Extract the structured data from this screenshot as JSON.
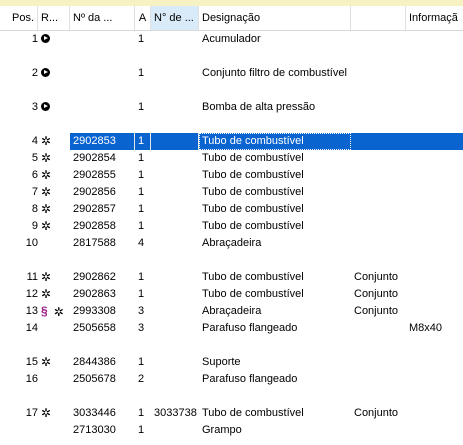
{
  "headers": {
    "pos": "Pos.",
    "ref": "R...",
    "part_no": "Nº da ...",
    "qty": "A",
    "alt_no": "N° de ...",
    "designation": "Designação",
    "assembly": "",
    "info": "Informaçã"
  },
  "rows": [
    {
      "pos": "1",
      "icon": "circle-arrow-icon",
      "num": "",
      "qty": "1",
      "alt": "",
      "desig": "Acumulador",
      "asm": "",
      "info": ""
    },
    {
      "pos": "",
      "icon": "",
      "num": "",
      "qty": "",
      "alt": "",
      "desig": "",
      "asm": "",
      "info": ""
    },
    {
      "pos": "2",
      "icon": "circle-arrow-icon",
      "num": "",
      "qty": "1",
      "alt": "",
      "desig": "Conjunto filtro de combustível",
      "asm": "",
      "info": ""
    },
    {
      "pos": "",
      "icon": "",
      "num": "",
      "qty": "",
      "alt": "",
      "desig": "",
      "asm": "",
      "info": ""
    },
    {
      "pos": "3",
      "icon": "circle-arrow-icon",
      "num": "",
      "qty": "1",
      "alt": "",
      "desig": "Bomba de alta pressão",
      "asm": "",
      "info": ""
    },
    {
      "pos": "",
      "icon": "",
      "num": "",
      "qty": "",
      "alt": "",
      "desig": "",
      "asm": "",
      "info": ""
    },
    {
      "pos": "4",
      "icon": "gear-icon",
      "num": "2902853",
      "qty": "1",
      "alt": "",
      "desig": "Tubo de combustível",
      "asm": "",
      "info": "",
      "selected": true
    },
    {
      "pos": "5",
      "icon": "gear-icon",
      "num": "2902854",
      "qty": "1",
      "alt": "",
      "desig": "Tubo de combustível",
      "asm": "",
      "info": ""
    },
    {
      "pos": "6",
      "icon": "gear-icon",
      "num": "2902855",
      "qty": "1",
      "alt": "",
      "desig": "Tubo de combustível",
      "asm": "",
      "info": ""
    },
    {
      "pos": "7",
      "icon": "gear-icon",
      "num": "2902856",
      "qty": "1",
      "alt": "",
      "desig": "Tubo de combustível",
      "asm": "",
      "info": ""
    },
    {
      "pos": "8",
      "icon": "gear-icon",
      "num": "2902857",
      "qty": "1",
      "alt": "",
      "desig": "Tubo de combustível",
      "asm": "",
      "info": ""
    },
    {
      "pos": "9",
      "icon": "gear-icon",
      "num": "2902858",
      "qty": "1",
      "alt": "",
      "desig": "Tubo de combustível",
      "asm": "",
      "info": ""
    },
    {
      "pos": "10",
      "icon": "",
      "num": "2817588",
      "qty": "4",
      "alt": "",
      "desig": "Abraçadeira",
      "asm": "",
      "info": ""
    },
    {
      "pos": "",
      "icon": "",
      "num": "",
      "qty": "",
      "alt": "",
      "desig": "",
      "asm": "",
      "info": ""
    },
    {
      "pos": "11",
      "icon": "gear-icon",
      "num": "2902862",
      "qty": "1",
      "alt": "",
      "desig": "Tubo de combustível",
      "asm": "Conjunto",
      "info": ""
    },
    {
      "pos": "12",
      "icon": "gear-icon",
      "num": "2902863",
      "qty": "1",
      "alt": "",
      "desig": "Tubo de combustível",
      "asm": "Conjunto",
      "info": ""
    },
    {
      "pos": "13",
      "icon": "gear-icon",
      "section": "§",
      "num": "2993308",
      "qty": "3",
      "alt": "",
      "desig": "Abraçadeira",
      "asm": "Conjunto",
      "info": ""
    },
    {
      "pos": "14",
      "icon": "",
      "num": "2505658",
      "qty": "3",
      "alt": "",
      "desig": "Parafuso flangeado",
      "asm": "",
      "info": "M8x40"
    },
    {
      "pos": "",
      "icon": "",
      "num": "",
      "qty": "",
      "alt": "",
      "desig": "",
      "asm": "",
      "info": ""
    },
    {
      "pos": "15",
      "icon": "gear-icon",
      "num": "2844386",
      "qty": "1",
      "alt": "",
      "desig": "Suporte",
      "asm": "",
      "info": ""
    },
    {
      "pos": "16",
      "icon": "",
      "num": "2505678",
      "qty": "2",
      "alt": "",
      "desig": "Parafuso flangeado",
      "asm": "",
      "info": ""
    },
    {
      "pos": "",
      "icon": "",
      "num": "",
      "qty": "",
      "alt": "",
      "desig": "",
      "asm": "",
      "info": ""
    },
    {
      "pos": "17",
      "icon": "gear-icon",
      "num": "3033446",
      "qty": "1",
      "alt": "3033738",
      "desig": "Tubo de combustível",
      "asm": "Conjunto",
      "info": ""
    },
    {
      "pos": "",
      "icon": "",
      "num": "2713030",
      "qty": "1",
      "alt": "",
      "desig": "Grampo",
      "asm": "",
      "info": ""
    }
  ]
}
